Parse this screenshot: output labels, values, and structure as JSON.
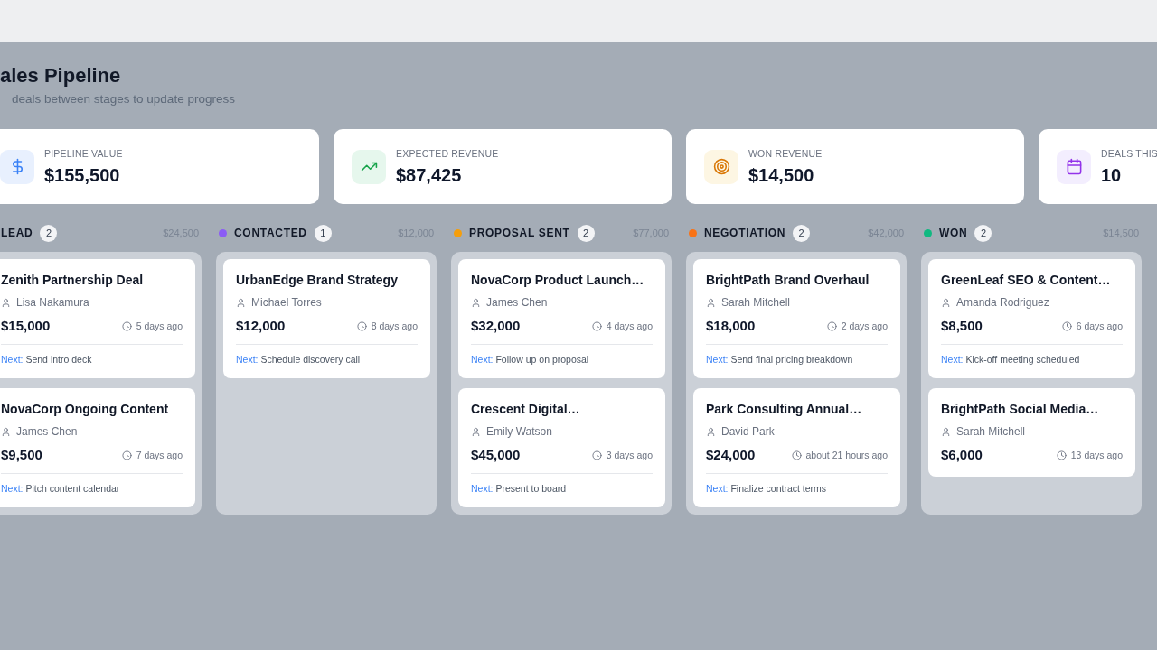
{
  "header": {
    "title": "ales Pipeline",
    "subtitle": "deals between stages to update progress"
  },
  "stats": [
    {
      "kind": "pipeline",
      "label": "PIPELINE VALUE",
      "value": "$155,500"
    },
    {
      "kind": "expected",
      "label": "EXPECTED REVENUE",
      "value": "$87,425"
    },
    {
      "kind": "won",
      "label": "WON REVENUE",
      "value": "$14,500"
    },
    {
      "kind": "deals",
      "label": "DEALS THIS",
      "value": "10"
    }
  ],
  "stages": [
    {
      "name": "LEAD",
      "count": "2",
      "total": "$24,500",
      "deals": [
        {
          "title": "Zenith Partnership Deal",
          "owner": "Lisa Nakamura",
          "amount": "$15,000",
          "time": "5 days ago",
          "next": {
            "label": "Next:",
            "text": "Send intro deck"
          }
        },
        {
          "title": "NovaCorp Ongoing Content",
          "owner": "James Chen",
          "amount": "$9,500",
          "time": "7 days ago",
          "next": {
            "label": "Next:",
            "text": "Pitch content calendar"
          }
        }
      ]
    },
    {
      "name": "CONTACTED",
      "color": "#8b5cf6",
      "count": "1",
      "total": "$12,000",
      "deals": [
        {
          "title": "UrbanEdge Brand Strategy",
          "owner": "Michael Torres",
          "amount": "$12,000",
          "time": "8 days ago",
          "next": {
            "label": "Next:",
            "text": "Schedule discovery call"
          }
        }
      ]
    },
    {
      "name": "PROPOSAL SENT",
      "color": "#f59e0b",
      "count": "2",
      "total": "$77,000",
      "deals": [
        {
          "title": "NovaCorp Product Launch…",
          "owner": "James Chen",
          "amount": "$32,000",
          "time": "4 days ago",
          "next": {
            "label": "Next:",
            "text": "Follow up on proposal"
          }
        },
        {
          "title": "Crescent Digital…",
          "owner": "Emily Watson",
          "amount": "$45,000",
          "time": "3 days ago",
          "next": {
            "label": "Next:",
            "text": "Present to board"
          }
        }
      ]
    },
    {
      "name": "NEGOTIATION",
      "color": "#f97316",
      "count": "2",
      "total": "$42,000",
      "deals": [
        {
          "title": "BrightPath Brand Overhaul",
          "owner": "Sarah Mitchell",
          "amount": "$18,000",
          "time": "2 days ago",
          "next": {
            "label": "Next:",
            "text": "Send final pricing breakdown"
          }
        },
        {
          "title": "Park Consulting Annual…",
          "owner": "David Park",
          "amount": "$24,000",
          "time": "about 21 hours ago",
          "next": {
            "label": "Next:",
            "text": "Finalize contract terms"
          }
        }
      ]
    },
    {
      "name": "WON",
      "color": "#10b981",
      "count": "2",
      "total": "$14,500",
      "deals": [
        {
          "title": "GreenLeaf SEO & Content…",
          "owner": "Amanda Rodriguez",
          "amount": "$8,500",
          "time": "6 days ago",
          "next": {
            "label": "Next:",
            "text": "Kick-off meeting scheduled"
          }
        },
        {
          "title": "BrightPath Social Media…",
          "owner": "Sarah Mitchell",
          "amount": "$6,000",
          "time": "13 days ago"
        }
      ]
    }
  ]
}
